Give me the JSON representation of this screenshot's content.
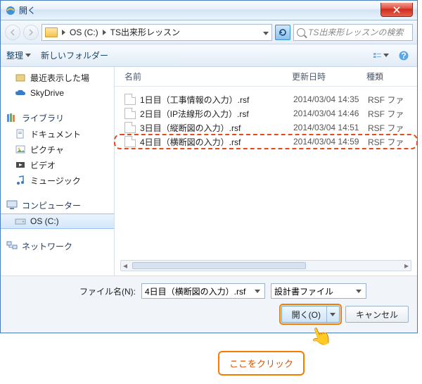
{
  "window": {
    "title": "開く"
  },
  "breadcrumb": {
    "drive": "OS (C:)",
    "folder": "TS出来形レッスン"
  },
  "search": {
    "placeholder": "TS出来形レッスンの検索"
  },
  "toolbar": {
    "organize": "整理",
    "newfolder": "新しいフォルダー"
  },
  "sidebar": {
    "recent": "最近表示した場",
    "skydrive": "SkyDrive",
    "libraries": "ライブラリ",
    "documents": "ドキュメント",
    "pictures": "ピクチャ",
    "videos": "ビデオ",
    "music": "ミュージック",
    "computer": "コンピューター",
    "osdrive": "OS (C:)",
    "network": "ネットワーク"
  },
  "columns": {
    "name": "名前",
    "date": "更新日時",
    "type": "種類"
  },
  "files": [
    {
      "name": "1日目（工事情報の入力）.rsf",
      "date": "2014/03/04 14:35",
      "type": "RSF ファ"
    },
    {
      "name": "2日目（IP法線形の入力）.rsf",
      "date": "2014/03/04 14:46",
      "type": "RSF ファ"
    },
    {
      "name": "3日目（縦断図の入力）.rsf",
      "date": "2014/03/04 14:51",
      "type": "RSF ファ"
    },
    {
      "name": "4日目（横断図の入力）.rsf",
      "date": "2014/03/04 14:59",
      "type": "RSF ファ"
    }
  ],
  "bottom": {
    "filename_label": "ファイル名(N):",
    "filename_value": "4日目（横断図の入力）.rsf",
    "filter_value": "設計書ファイル",
    "open_label": "開く(O)",
    "cancel_label": "キャンセル"
  },
  "annotation": {
    "callout": "ここをクリック"
  }
}
